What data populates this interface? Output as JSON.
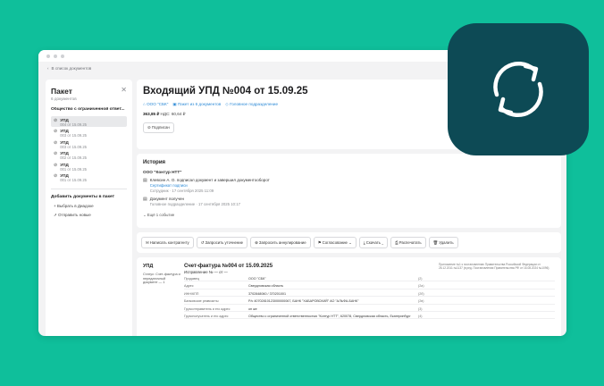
{
  "breadcrumb": {
    "back_label": "В список документов"
  },
  "sidebar": {
    "title": "Пакет",
    "subtitle": "6 документов",
    "org": "Общество с ограниченной ответ...",
    "docs": [
      {
        "name": "УПД",
        "date": "004 от 15.09.25"
      },
      {
        "name": "УПД",
        "date": "003 от 15.09.25"
      },
      {
        "name": "УПД",
        "date": "003 от 15.09.25"
      },
      {
        "name": "УПД",
        "date": "002 от 15.09.25"
      },
      {
        "name": "УПД",
        "date": "001 от 15.09.25"
      },
      {
        "name": "УПД",
        "date": "001 от 15.09.25"
      }
    ],
    "add_title": "Добавить документы в пакет",
    "select_label": "Выбрать в Диадоке",
    "send_label": "Отправить новые"
  },
  "document": {
    "title": "Входящий УПД №004 от 15.09.25",
    "link_org": "ООО \"СБК\"",
    "link_packet": "Пакет из 6 документов",
    "link_dept": "Головное подразделение",
    "amount": "363,85 ₽",
    "vat": "НДС: 60,64 ₽",
    "status": "Подписан"
  },
  "history": {
    "title": "История",
    "org": "ООО \"Контур НТТ\"",
    "event1_text": "Клевсин А. О. подписал документ и завершил документооборот",
    "event1_link": "Сертификат подписи",
    "event1_meta": "Сотрудник · 17 сентября 2025 11:09",
    "event2_text": "Документ получен",
    "event2_meta": "Головное подразделение · 17 сентября 2025 10:17",
    "more": "Ещё 1 событие"
  },
  "toolbar": {
    "write": "Написать контрагенту",
    "clarify": "Запросить уточнение",
    "annul": "Запросить аннулирование",
    "approve": "Согласование",
    "download": "Скачать",
    "print": "Распечатать",
    "delete": "Удалить"
  },
  "preview": {
    "label": "УПД",
    "status": "Статус: Счет-фактура и передаточный документ — 1",
    "title": "Счет-фактура №004 от 15.09.2025",
    "correction": "Исправление № — от —",
    "note": "Приложение №1 к постановлению Правительства Российской Федерации от 26.12.2011 №1137 (в ред. Постановления Правительства РФ от 16.08.2024 №1096)",
    "rows": [
      {
        "k": "Продавец",
        "v": "ООО \"СБК\"",
        "n": "(2)"
      },
      {
        "k": "Адрес",
        "v": "Свердловская область",
        "n": "(2а)"
      },
      {
        "k": "ИНН/КПП",
        "v": "3702848060 / 370201001",
        "n": "(2б)"
      },
      {
        "k": "Банковские реквизиты",
        "v": "Р/с 40702810123000000067, БАНК \"ХАБАРОВСКИЙ\" АО \"АЛЬФА-БАНК\"",
        "n": "(2в)"
      },
      {
        "k": "Грузоотправитель и его адрес",
        "v": "он же",
        "n": "(3)"
      },
      {
        "k": "Грузополучатель и его адрес",
        "v": "Общество с ограниченной ответственностью \"Контур НТТ\", 620078, Свердловская область, Екатеринбург",
        "n": "(4)"
      }
    ]
  }
}
